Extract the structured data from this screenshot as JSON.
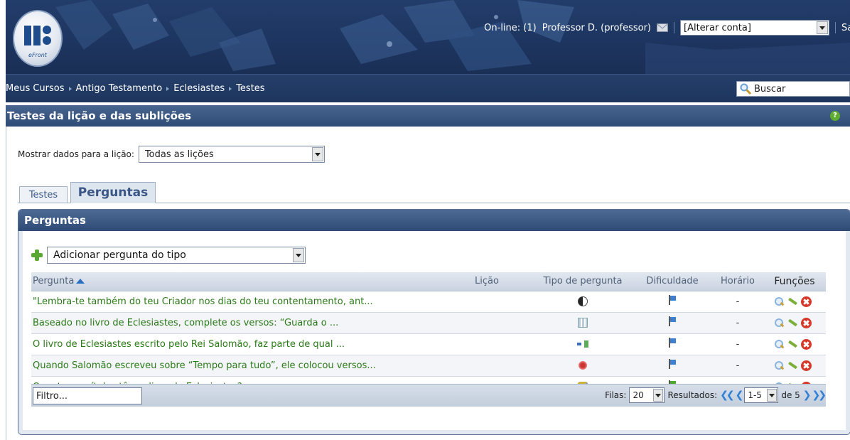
{
  "header": {
    "logo_text": "eFront",
    "online_label": "On-line: (1)",
    "user_label": "Professor D. (professor)",
    "account_select": "[Alterar conta]",
    "logout_fragment": "Sa"
  },
  "breadcrumb": [
    "Meus Cursos",
    "Antigo Testamento",
    "Eclesiastes",
    "Testes"
  ],
  "search": {
    "label": "Buscar",
    "icon": "search-icon"
  },
  "page": {
    "title": "Testes da lição e das sublições",
    "help_icon": "help-icon"
  },
  "lesson_filter": {
    "label": "Mostrar dados para a lição:",
    "selected": "Todas as lições"
  },
  "tabs": [
    {
      "label": "Testes",
      "active": false
    },
    {
      "label": "Perguntas",
      "active": true
    }
  ],
  "panel": {
    "title": "Perguntas",
    "add_select": "Adicionar pergunta do tipo"
  },
  "table": {
    "columns": [
      "Pergunta",
      "Lição",
      "Tipo de pergunta",
      "Dificuldade",
      "Horário",
      "Funções"
    ],
    "rows": [
      {
        "question": "\"Lembra-te também do teu Criador nos dias do teu contentamento, ant...",
        "lesson": "",
        "type_icon": "yin-yang-icon",
        "difficulty": "blue",
        "time": "-"
      },
      {
        "question": "Baseado no livro de Eclesiastes, complete os versos:  “Guarda o ...",
        "lesson": "",
        "type_icon": "fill-blanks-icon",
        "difficulty": "blue",
        "time": "-"
      },
      {
        "question": "O livro de Eclesiastes escrito pelo Rei Salomão, faz parte de qual ...",
        "lesson": "",
        "type_icon": "match-icon",
        "difficulty": "blue",
        "time": "-"
      },
      {
        "question": "Quando Salomão escreveu sobre “Tempo para tudo”, ele colocou versos...",
        "lesson": "",
        "type_icon": "multiple-choice-icon",
        "difficulty": "blue",
        "time": "-"
      },
      {
        "question": "Quantos capítulos têm o livro de Eclesiastes?",
        "lesson": "",
        "type_icon": "true-false-icon",
        "difficulty": "green",
        "time": "-"
      }
    ]
  },
  "footer": {
    "filter_placeholder": "Filtro...",
    "rows_label": "Filas:",
    "rows_value": "20",
    "results_label": "Resultados:",
    "range_value": "1-5",
    "total_label": "de 5"
  },
  "colors": {
    "header_bg": "#1d3560",
    "title_bar": "#3d5a84",
    "question_link": "#2a7a17",
    "accent_blue": "#2f7fd4"
  }
}
